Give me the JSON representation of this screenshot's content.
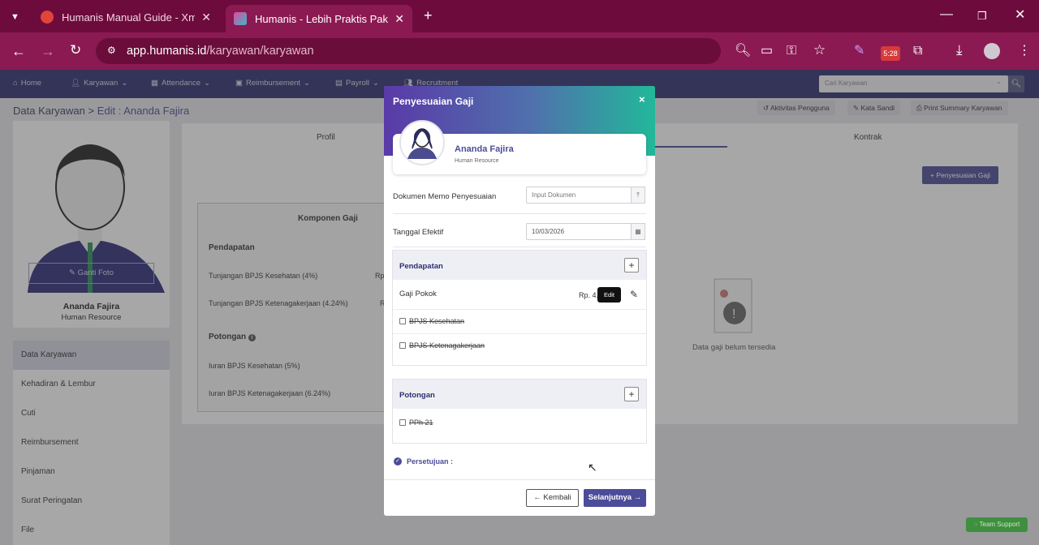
{
  "browser": {
    "tabs": [
      {
        "title": "Humanis Manual Guide - Xmind",
        "active": false
      },
      {
        "title": "Humanis - Lebih Praktis Pakai Humanis",
        "active": true
      }
    ],
    "url_host": "app.humanis.id",
    "url_path": "/karyawan/karyawan",
    "badge_time": "5:28"
  },
  "nav": {
    "items": [
      "Home",
      "Karyawan",
      "Attendance",
      "Reimbursement",
      "Payroll",
      "Recruitment"
    ],
    "search_placeholder": "Cari Karyawan"
  },
  "breadcrumb": {
    "root": "Data Karyawan",
    "sep": ">",
    "current": "Edit : Ananda Fajira"
  },
  "top_actions": [
    "Aktivitas Pengguna",
    "Kata Sandi",
    "Print Summary Karyawan"
  ],
  "employee": {
    "name": "Ananda Fajira",
    "role": "Human Resource",
    "change_photo": "Ganti Foto"
  },
  "side_menu": [
    "Data Karyawan",
    "Kehadiran & Lembur",
    "Cuti",
    "Reimbursement",
    "Pinjaman",
    "Surat Peringatan",
    "File"
  ],
  "main": {
    "tabs": [
      "Profil",
      "Kontrak"
    ],
    "adjust_button": "Penyesuaian Gaji",
    "component_title": "Komponen Gaji",
    "income_title": "Pendapatan",
    "income_rows": [
      {
        "label": "Tunjangan BPJS Kesehatan (4%)",
        "value": "Rp"
      },
      {
        "label": "Tunjangan BPJS Ketenagakerjaan (4.24%)",
        "value": "R"
      }
    ],
    "deduction_title": "Potongan",
    "deduction_rows": [
      "Iuran BPJS Kesehatan (5%)",
      "Iuran BPJS Ketenagakerjaan (6.24%)"
    ],
    "empty_text": "Data gaji belum tersedia"
  },
  "modal": {
    "title": "Penyesuaian Gaji",
    "close": "×",
    "name": "Ananda Fajira",
    "role": "Human Resource",
    "doc_label": "Dokumen Memo Penyesuaian",
    "doc_placeholder": "Input Dokumen",
    "date_label": "Tanggal Efektif",
    "date_value": "10/03/2026",
    "income": {
      "title": "Pendapatan",
      "base_label": "Gaji Pokok",
      "base_value": "Rp. 4.",
      "tooltip": "Edit",
      "options": [
        "BPJS Kesehatan",
        "BPJS Ketenagakerjaan"
      ]
    },
    "deduction": {
      "title": "Potongan",
      "options": [
        "PPh 21"
      ]
    },
    "approval": "Persetujuan :",
    "back": "Kembali",
    "next": "Selanjutnya"
  },
  "support_button": "Team Support",
  "colors": {
    "chrome": "#8b1a52",
    "nav": "#2e2f6f",
    "accent": "#4b4c9a",
    "teal": "#22b89a"
  }
}
